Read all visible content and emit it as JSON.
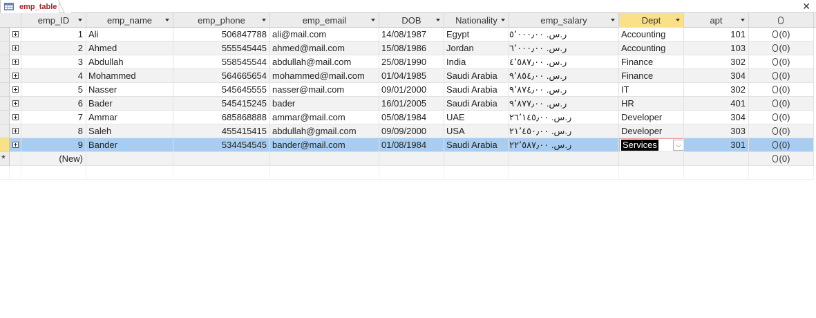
{
  "tab": {
    "title": "emp_table",
    "close_glyph": "✕"
  },
  "columns": [
    {
      "key": "emp_ID",
      "label": "emp_ID"
    },
    {
      "key": "emp_name",
      "label": "emp_name"
    },
    {
      "key": "emp_phone",
      "label": "emp_phone"
    },
    {
      "key": "emp_email",
      "label": "emp_email"
    },
    {
      "key": "DOB",
      "label": "DOB"
    },
    {
      "key": "Nationality",
      "label": "Nationality"
    },
    {
      "key": "emp_salary",
      "label": "emp_salary"
    },
    {
      "key": "Dept",
      "label": "Dept"
    },
    {
      "key": "apt",
      "label": "apt"
    },
    {
      "key": "attachment",
      "label": ""
    }
  ],
  "rows": [
    {
      "emp_ID": "1",
      "emp_name": "Ali",
      "emp_phone": "506847788",
      "emp_email": "ali@mail.com",
      "DOB": "14/08/1987",
      "Nationality": "Egypt",
      "emp_salary": "ر.س.‏ ٥٬٠٠٠٫٠٠",
      "Dept": "Accounting",
      "apt": "101",
      "attachment": "(0)"
    },
    {
      "emp_ID": "2",
      "emp_name": "Ahmed",
      "emp_phone": "555545445",
      "emp_email": "ahmed@mail.com",
      "DOB": "15/08/1986",
      "Nationality": "Jordan",
      "emp_salary": "ر.س.‏ ٦٬٠٠٠٫٠٠",
      "Dept": "Accounting",
      "apt": "103",
      "attachment": "(0)"
    },
    {
      "emp_ID": "3",
      "emp_name": "Abdullah",
      "emp_phone": "558545544",
      "emp_email": "abdullah@mail.com",
      "DOB": "25/08/1990",
      "Nationality": "India",
      "emp_salary": "ر.س.‏ ٤٬٥٨٧٫٠٠",
      "Dept": "Finance",
      "apt": "302",
      "attachment": "(0)"
    },
    {
      "emp_ID": "4",
      "emp_name": "Mohammed",
      "emp_phone": "564665654",
      "emp_email": "mohammed@mail.com",
      "DOB": "01/04/1985",
      "Nationality": "Saudi Arabia",
      "emp_salary": "ر.س.‏ ٩٬٨٥٤٫٠٠",
      "Dept": "Finance",
      "apt": "304",
      "attachment": "(0)"
    },
    {
      "emp_ID": "5",
      "emp_name": "Nasser",
      "emp_phone": "545645555",
      "emp_email": "nasser@mail.com",
      "DOB": "09/01/2000",
      "Nationality": "Saudi Arabia",
      "emp_salary": "ر.س.‏ ٩٬٨٧٤٫٠٠",
      "Dept": "IT",
      "apt": "302",
      "attachment": "(0)"
    },
    {
      "emp_ID": "6",
      "emp_name": "Bader",
      "emp_phone": "545415245",
      "emp_email": "bader",
      "DOB": "16/01/2005",
      "Nationality": "Saudi Arabia",
      "emp_salary": "ر.س.‏ ٩٬٨٧٧٫٠٠",
      "Dept": "HR",
      "apt": "401",
      "attachment": "(0)"
    },
    {
      "emp_ID": "7",
      "emp_name": "Ammar",
      "emp_phone": "685868888",
      "emp_email": "ammar@mail.com",
      "DOB": "05/08/1984",
      "Nationality": "UAE",
      "emp_salary": "ر.س.‏ ٢٦٬١٤٥٫٠٠",
      "Dept": "Developer",
      "apt": "304",
      "attachment": "(0)"
    },
    {
      "emp_ID": "8",
      "emp_name": "Saleh",
      "emp_phone": "455415415",
      "emp_email": "abdullah@gmail.com",
      "DOB": "09/09/2000",
      "Nationality": "USA",
      "emp_salary": "ر.س.‏ ٢١٬٤٥٠٫٠٠",
      "Dept": "Developer",
      "apt": "303",
      "attachment": "(0)"
    },
    {
      "emp_ID": "9",
      "emp_name": "Bander",
      "emp_phone": "534454545",
      "emp_email": "bander@mail.com",
      "DOB": "01/08/1984",
      "Nationality": "Saudi Arabia",
      "emp_salary": "ر.س.‏ ٢٢٬٥٨٧٫٠٠",
      "Dept": "Services",
      "apt": "301",
      "attachment": "(0)"
    }
  ],
  "current_row_index": 8,
  "new_row": {
    "label": "(New)",
    "attachment": "(0)",
    "marker": "*"
  },
  "icons": {
    "attachment": "paperclip-icon",
    "dropdown": "chevron-down-icon",
    "table": "table-icon",
    "expand": "expand-plus-icon"
  },
  "colors": {
    "selected_header": "#fbe08a",
    "current_row": "#a8cdf0",
    "tab_title": "#a4262c"
  }
}
